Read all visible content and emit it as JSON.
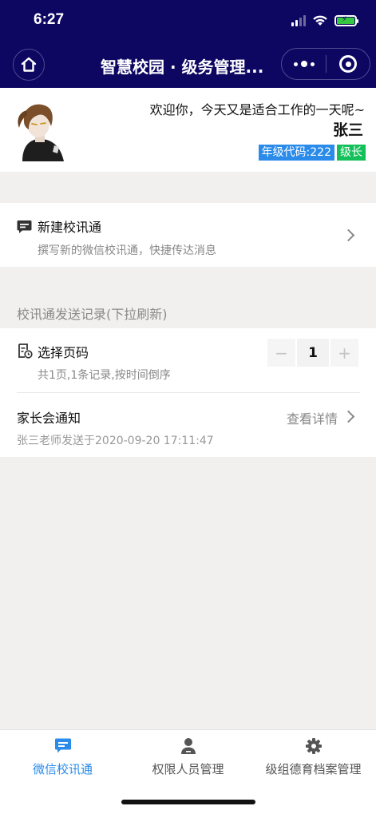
{
  "status_bar": {
    "time": "6:27"
  },
  "nav": {
    "title": "智慧校园 · 级务管理..."
  },
  "user": {
    "welcome": "欢迎你，今天又是适合工作的一天呢~",
    "name": "张三",
    "grade_code": "年级代码:222",
    "role": "级长"
  },
  "new_message": {
    "title": "新建校讯通",
    "desc": "撰写新的微信校讯通，快捷传达消息"
  },
  "records": {
    "section_title": "校讯通发送记录(下拉刷新)",
    "page_select_title": "选择页码",
    "page_select_desc": "共1页,1条记录,按时间倒序",
    "stepper": {
      "minus": "−",
      "value": "1",
      "plus": "+"
    },
    "items": [
      {
        "title": "家长会通知",
        "sub": "张三老师发送于2020-09-20 17:11:47",
        "link": "查看详情"
      }
    ]
  },
  "tabbar": [
    {
      "label": "微信校讯通",
      "icon": "message-icon",
      "active": true
    },
    {
      "label": "权限人员管理",
      "icon": "person-icon",
      "active": false
    },
    {
      "label": "级组德育档案管理",
      "icon": "gear-icon",
      "active": false
    }
  ],
  "colors": {
    "header": "#0d0762",
    "accent": "#2a8bea",
    "green_badge": "#14c05a",
    "background": "#f1f0ee"
  }
}
